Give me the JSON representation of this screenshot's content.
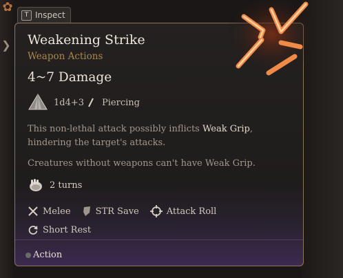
{
  "inspect": {
    "key": "T",
    "label": "Inspect"
  },
  "tooltip": {
    "title": "Weakening Strike",
    "subtitle": "Weapon Actions",
    "damage": "4~7 Damage",
    "dice": "1d4+3",
    "damage_type": "Piercing",
    "description": {
      "before": "This non-lethal attack possibly inflicts ",
      "highlight": "Weak Grip",
      "after": ", hindering the target's attacks."
    },
    "note": "Creatures without weapons can't have Weak Grip.",
    "duration": "2 turns",
    "properties": [
      {
        "label": "Melee",
        "icon": "crossed-swords-icon"
      },
      {
        "label": "STR Save",
        "icon": "shield-icon"
      },
      {
        "label": "Attack Roll",
        "icon": "crosshair-icon"
      }
    ],
    "rest": {
      "label": "Short Rest",
      "icon": "recharge-icon"
    },
    "action_cost": "Action"
  },
  "colors": {
    "title": "#efe7dd",
    "subtitle": "#a8874e",
    "body_text": "#a2988e",
    "highlight": "#e4d9cc",
    "border": "#8b765e",
    "footer_purple": "#3d2a50",
    "skill_glow": "#e9743a"
  }
}
